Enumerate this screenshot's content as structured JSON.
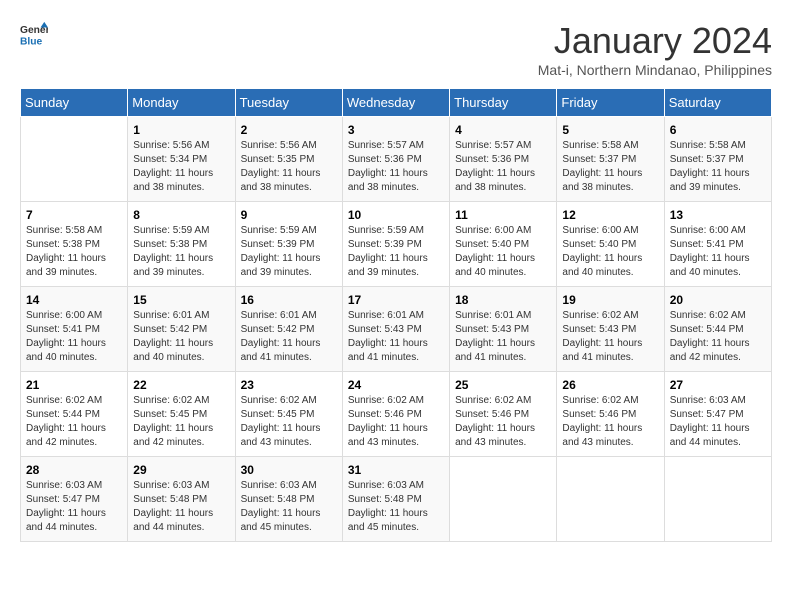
{
  "header": {
    "logo_line1": "General",
    "logo_line2": "Blue",
    "title": "January 2024",
    "subtitle": "Mat-i, Northern Mindanao, Philippines"
  },
  "columns": [
    "Sunday",
    "Monday",
    "Tuesday",
    "Wednesday",
    "Thursday",
    "Friday",
    "Saturday"
  ],
  "weeks": [
    [
      {
        "day": "",
        "info": ""
      },
      {
        "day": "1",
        "info": "Sunrise: 5:56 AM\nSunset: 5:34 PM\nDaylight: 11 hours\nand 38 minutes."
      },
      {
        "day": "2",
        "info": "Sunrise: 5:56 AM\nSunset: 5:35 PM\nDaylight: 11 hours\nand 38 minutes."
      },
      {
        "day": "3",
        "info": "Sunrise: 5:57 AM\nSunset: 5:36 PM\nDaylight: 11 hours\nand 38 minutes."
      },
      {
        "day": "4",
        "info": "Sunrise: 5:57 AM\nSunset: 5:36 PM\nDaylight: 11 hours\nand 38 minutes."
      },
      {
        "day": "5",
        "info": "Sunrise: 5:58 AM\nSunset: 5:37 PM\nDaylight: 11 hours\nand 38 minutes."
      },
      {
        "day": "6",
        "info": "Sunrise: 5:58 AM\nSunset: 5:37 PM\nDaylight: 11 hours\nand 39 minutes."
      }
    ],
    [
      {
        "day": "7",
        "info": "Sunrise: 5:58 AM\nSunset: 5:38 PM\nDaylight: 11 hours\nand 39 minutes."
      },
      {
        "day": "8",
        "info": "Sunrise: 5:59 AM\nSunset: 5:38 PM\nDaylight: 11 hours\nand 39 minutes."
      },
      {
        "day": "9",
        "info": "Sunrise: 5:59 AM\nSunset: 5:39 PM\nDaylight: 11 hours\nand 39 minutes."
      },
      {
        "day": "10",
        "info": "Sunrise: 5:59 AM\nSunset: 5:39 PM\nDaylight: 11 hours\nand 39 minutes."
      },
      {
        "day": "11",
        "info": "Sunrise: 6:00 AM\nSunset: 5:40 PM\nDaylight: 11 hours\nand 40 minutes."
      },
      {
        "day": "12",
        "info": "Sunrise: 6:00 AM\nSunset: 5:40 PM\nDaylight: 11 hours\nand 40 minutes."
      },
      {
        "day": "13",
        "info": "Sunrise: 6:00 AM\nSunset: 5:41 PM\nDaylight: 11 hours\nand 40 minutes."
      }
    ],
    [
      {
        "day": "14",
        "info": "Sunrise: 6:00 AM\nSunset: 5:41 PM\nDaylight: 11 hours\nand 40 minutes."
      },
      {
        "day": "15",
        "info": "Sunrise: 6:01 AM\nSunset: 5:42 PM\nDaylight: 11 hours\nand 40 minutes."
      },
      {
        "day": "16",
        "info": "Sunrise: 6:01 AM\nSunset: 5:42 PM\nDaylight: 11 hours\nand 41 minutes."
      },
      {
        "day": "17",
        "info": "Sunrise: 6:01 AM\nSunset: 5:43 PM\nDaylight: 11 hours\nand 41 minutes."
      },
      {
        "day": "18",
        "info": "Sunrise: 6:01 AM\nSunset: 5:43 PM\nDaylight: 11 hours\nand 41 minutes."
      },
      {
        "day": "19",
        "info": "Sunrise: 6:02 AM\nSunset: 5:43 PM\nDaylight: 11 hours\nand 41 minutes."
      },
      {
        "day": "20",
        "info": "Sunrise: 6:02 AM\nSunset: 5:44 PM\nDaylight: 11 hours\nand 42 minutes."
      }
    ],
    [
      {
        "day": "21",
        "info": "Sunrise: 6:02 AM\nSunset: 5:44 PM\nDaylight: 11 hours\nand 42 minutes."
      },
      {
        "day": "22",
        "info": "Sunrise: 6:02 AM\nSunset: 5:45 PM\nDaylight: 11 hours\nand 42 minutes."
      },
      {
        "day": "23",
        "info": "Sunrise: 6:02 AM\nSunset: 5:45 PM\nDaylight: 11 hours\nand 43 minutes."
      },
      {
        "day": "24",
        "info": "Sunrise: 6:02 AM\nSunset: 5:46 PM\nDaylight: 11 hours\nand 43 minutes."
      },
      {
        "day": "25",
        "info": "Sunrise: 6:02 AM\nSunset: 5:46 PM\nDaylight: 11 hours\nand 43 minutes."
      },
      {
        "day": "26",
        "info": "Sunrise: 6:02 AM\nSunset: 5:46 PM\nDaylight: 11 hours\nand 43 minutes."
      },
      {
        "day": "27",
        "info": "Sunrise: 6:03 AM\nSunset: 5:47 PM\nDaylight: 11 hours\nand 44 minutes."
      }
    ],
    [
      {
        "day": "28",
        "info": "Sunrise: 6:03 AM\nSunset: 5:47 PM\nDaylight: 11 hours\nand 44 minutes."
      },
      {
        "day": "29",
        "info": "Sunrise: 6:03 AM\nSunset: 5:48 PM\nDaylight: 11 hours\nand 44 minutes."
      },
      {
        "day": "30",
        "info": "Sunrise: 6:03 AM\nSunset: 5:48 PM\nDaylight: 11 hours\nand 45 minutes."
      },
      {
        "day": "31",
        "info": "Sunrise: 6:03 AM\nSunset: 5:48 PM\nDaylight: 11 hours\nand 45 minutes."
      },
      {
        "day": "",
        "info": ""
      },
      {
        "day": "",
        "info": ""
      },
      {
        "day": "",
        "info": ""
      }
    ]
  ]
}
